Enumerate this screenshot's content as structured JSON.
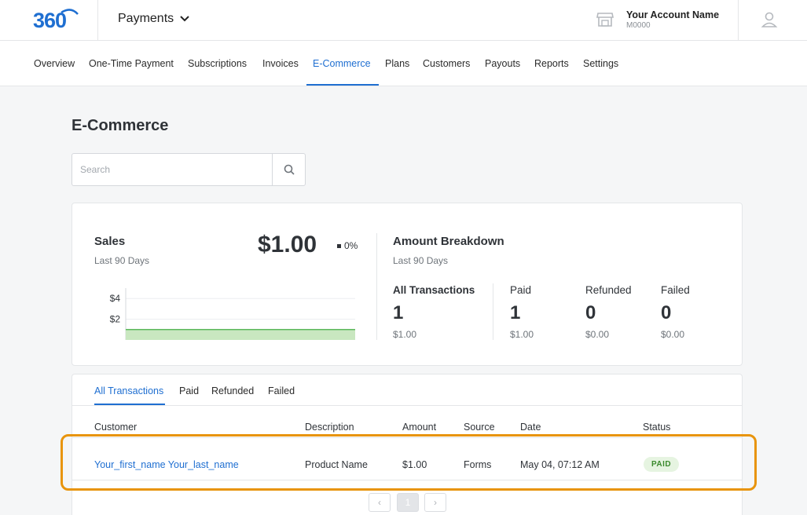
{
  "colors": {
    "accent": "#1f6fd1",
    "highlight": "#e8940c",
    "paid_badge_bg": "#e6f4e1",
    "paid_badge_text": "#3b8a2d",
    "chart_fill": "#c9e7c0",
    "chart_line": "#5cb85c"
  },
  "header": {
    "logo_icon": "360-logo",
    "app_name": "Payments",
    "app_dropdown_icon": "chevron-down-icon",
    "store_icon": "store-icon",
    "account_name": "Your Account Name",
    "account_id": "M0000",
    "user_icon": "user-icon"
  },
  "nav": {
    "items": [
      {
        "label": "Overview"
      },
      {
        "label": "One-Time Payment"
      },
      {
        "label": "Subscriptions"
      },
      {
        "label": "Invoices"
      },
      {
        "label": "E-Commerce"
      },
      {
        "label": "Plans"
      },
      {
        "label": "Customers"
      },
      {
        "label": "Payouts"
      },
      {
        "label": "Reports"
      },
      {
        "label": "Settings"
      }
    ],
    "active": "E-Commerce"
  },
  "page": {
    "title": "E-Commerce",
    "search_placeholder": "Search",
    "search_icon": "search-icon"
  },
  "sales": {
    "title": "Sales",
    "period": "Last 90 Days",
    "amount": "$1.00",
    "change": "0%"
  },
  "breakdown": {
    "title": "Amount Breakdown",
    "period": "Last 90 Days",
    "stats": [
      {
        "label": "All Transactions",
        "count": "1",
        "amount": "$1.00"
      },
      {
        "label": "Paid",
        "count": "1",
        "amount": "$1.00"
      },
      {
        "label": "Refunded",
        "count": "0",
        "amount": "$0.00"
      },
      {
        "label": "Failed",
        "count": "0",
        "amount": "$0.00"
      }
    ]
  },
  "chart_data": {
    "type": "area",
    "y_tick_labels": [
      "$4",
      "$2"
    ],
    "ylim": [
      0,
      5
    ],
    "series": [
      {
        "values": [
          1,
          1
        ]
      }
    ]
  },
  "transactions": {
    "tabs": [
      {
        "label": "All Transactions"
      },
      {
        "label": "Paid"
      },
      {
        "label": "Refunded"
      },
      {
        "label": "Failed"
      }
    ],
    "active_tab": "All Transactions",
    "columns": [
      "Customer",
      "Description",
      "Amount",
      "Source",
      "Date",
      "Status"
    ],
    "rows": [
      {
        "customer": "Your_first_name Your_last_name",
        "description": "Product Name",
        "amount": "$1.00",
        "source": "Forms",
        "date": "May 04, 07:12 AM",
        "status": "PAID"
      }
    ],
    "pagination": {
      "prev": "‹",
      "current": "1",
      "next": "›"
    }
  }
}
